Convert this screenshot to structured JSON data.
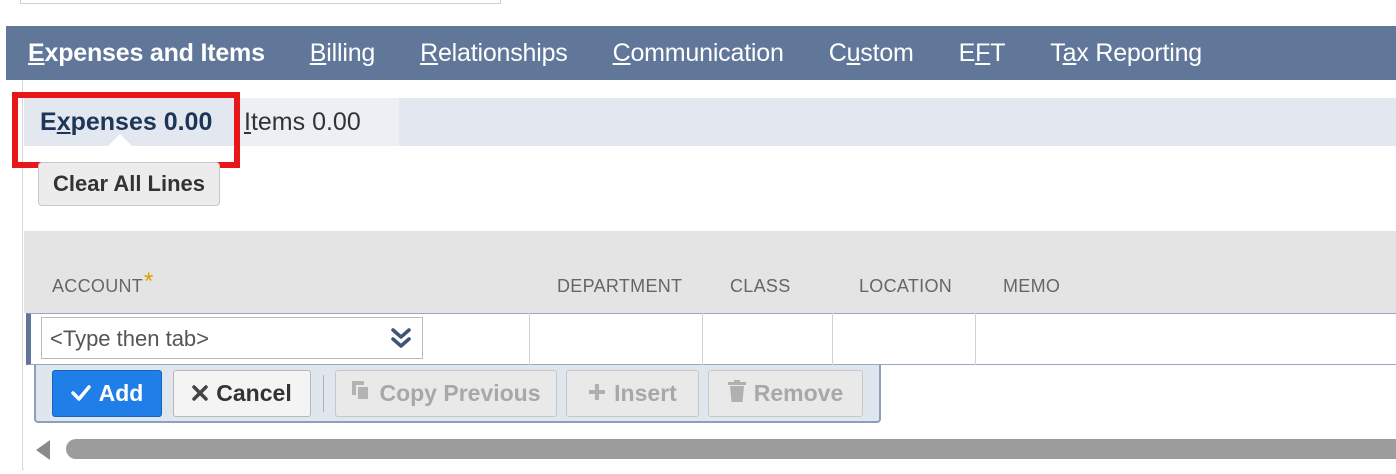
{
  "main_tabs": [
    {
      "pre": "",
      "key": "E",
      "post": "xpenses and Items",
      "active": true
    },
    {
      "pre": "",
      "key": "B",
      "post": "illing",
      "active": false
    },
    {
      "pre": "",
      "key": "R",
      "post": "elationships",
      "active": false
    },
    {
      "pre": "",
      "key": "C",
      "post": "ommunication",
      "active": false
    },
    {
      "pre": "C",
      "key": "u",
      "post": "stom",
      "active": false
    },
    {
      "pre": "E",
      "key": "F",
      "post": "T",
      "active": false
    },
    {
      "pre": "T",
      "key": "a",
      "post": "x Reporting",
      "active": false
    }
  ],
  "sub_tabs": {
    "expenses": {
      "pre": "E",
      "key": "x",
      "post": "penses 0.00"
    },
    "items": {
      "key": "I",
      "post": "tems 0.00"
    }
  },
  "clear_all_label": "Clear All Lines",
  "columns": {
    "account": "ACCOUNT",
    "required_mark": "*",
    "department": "DEPARTMENT",
    "class": "CLASS",
    "location": "LOCATION",
    "memo": "MEMO"
  },
  "account_input": {
    "placeholder": "<Type then tab>"
  },
  "buttons": {
    "add": "Add",
    "cancel": "Cancel",
    "copy_previous": "Copy Previous",
    "insert": "Insert",
    "remove": "Remove"
  },
  "colors": {
    "tab_bar": "#607799",
    "highlight": "#e8161b",
    "add_button": "#1f7ee8"
  },
  "icons": {
    "add": "check-icon",
    "cancel": "x-icon",
    "copy": "copy-icon",
    "insert": "plus-icon",
    "remove": "trash-icon",
    "dropdown": "double-chevron-down-icon",
    "scroll_left": "arrow-left-icon"
  }
}
